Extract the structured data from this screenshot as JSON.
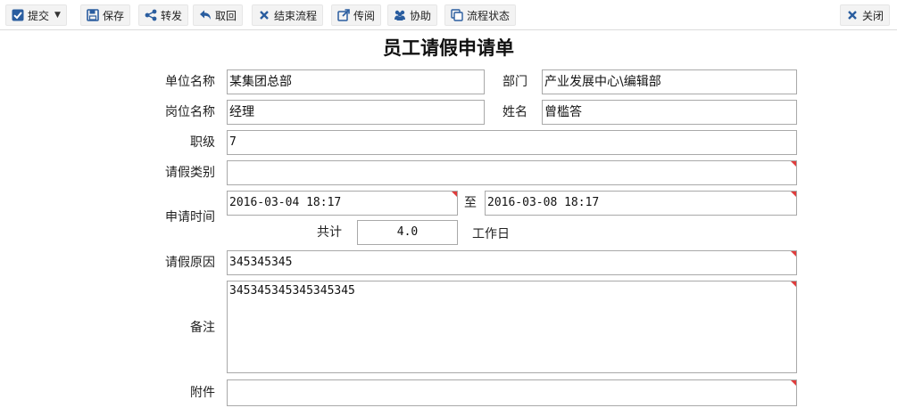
{
  "toolbar": {
    "submit_label": "提交",
    "save_label": "保存",
    "forward_label": "转发",
    "retrieve_label": "取回",
    "end_flow_label": "结束流程",
    "circulate_label": "传阅",
    "assist_label": "协助",
    "flow_status_label": "流程状态",
    "close_label": "关闭"
  },
  "form": {
    "title": "员工请假申请单",
    "unit_name_label": "单位名称",
    "unit_name_value": "某集团总部",
    "department_label": "部门",
    "department_value": "产业发展中心\\编辑部",
    "position_label": "岗位名称",
    "position_value": "经理",
    "name_label": "姓名",
    "name_value": "曾槛答",
    "rank_label": "职级",
    "rank_value": "7",
    "leave_type_label": "请假类别",
    "leave_type_value": "",
    "apply_time_label": "申请时间",
    "start_time_value": "2016-03-04 18:17",
    "to_label": "至",
    "end_time_value": "2016-03-08 18:17",
    "total_label": "共计",
    "total_value": "4.0",
    "workday_label": "工作日",
    "reason_label": "请假原因",
    "reason_value": "345345345",
    "remark_label": "备注",
    "remark_value": "345345345345345345",
    "attachment_label": "附件",
    "attachment_value": ""
  },
  "colors": {
    "icon_blue": "#2a5d9f",
    "required_marker": "#e03c3c",
    "field_border": "#a9a9a9",
    "button_bg": "#f3f3f3"
  },
  "icons": {
    "submit": "checkbox-icon",
    "save": "floppy-icon",
    "forward": "share-icon",
    "retrieve": "reply-icon",
    "end_flow": "x-icon",
    "circulate": "external-link-icon",
    "assist": "users-icon",
    "flow_status": "copy-icon",
    "close": "x-icon"
  }
}
